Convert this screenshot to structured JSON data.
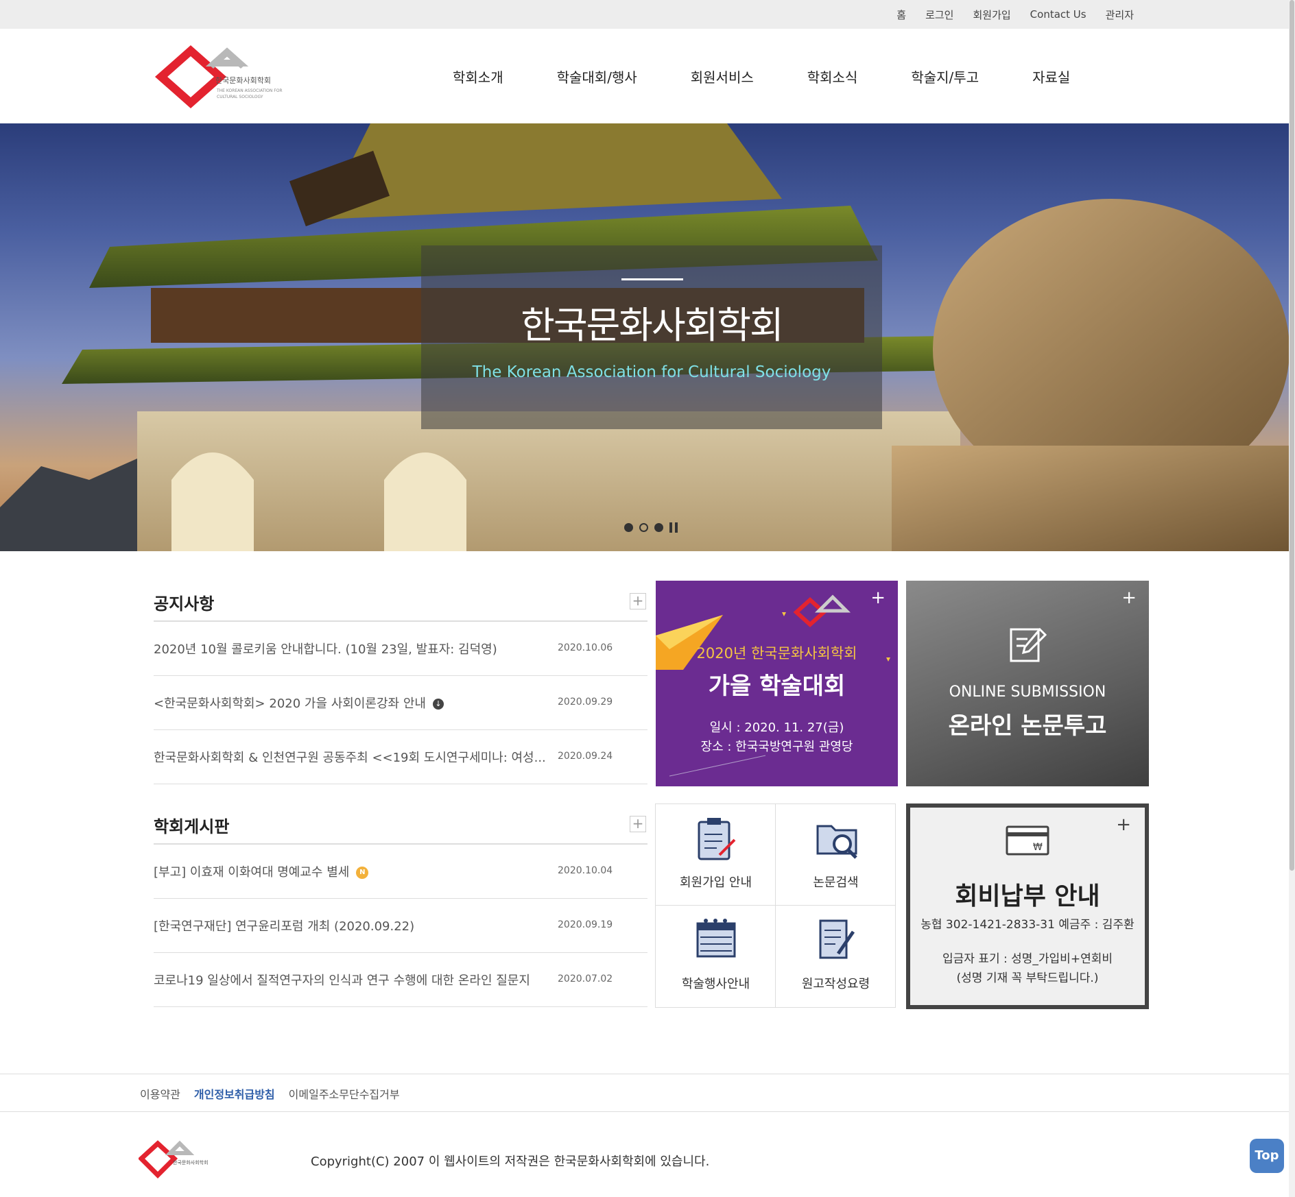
{
  "topbar": {
    "links": [
      "홈",
      "로그인",
      "회원가입",
      "Contact Us",
      "관리자"
    ]
  },
  "header": {
    "logo_ko": "한국문화사회학회",
    "logo_en1": "THE KOREAN ASSOCIATION FOR",
    "logo_en2": "CULTURAL SOCIOLOGY",
    "nav": [
      "학회소개",
      "학술대회/행사",
      "회원서비스",
      "학회소식",
      "학술지/투고",
      "자료실"
    ]
  },
  "hero": {
    "title": "한국문화사회학회",
    "subtitle": "The Korean Association for Cultural Sociology",
    "slides_total": 3,
    "active_slide": 1
  },
  "notice": {
    "title": "공지사항",
    "more": "+",
    "rows": [
      {
        "title": "2020년 10월 콜로키움 안내합니다. (10월 23일, 발표자: 김덕영)",
        "date": "2020.10.06",
        "badge": ""
      },
      {
        "title": "<한국문화사회학회> 2020 가을 사회이론강좌 안내",
        "date": "2020.09.29",
        "badge": "download"
      },
      {
        "title": "한국문화사회학회 & 인천연구원 공동주최 <<19회 도시연구세미나: 여성...",
        "date": "2020.09.24",
        "badge": ""
      }
    ]
  },
  "board": {
    "title": "학회게시판",
    "more": "+",
    "rows": [
      {
        "title": "[부고] 이효재 이화여대 명예교수 별세",
        "date": "2020.10.04",
        "badge": "N"
      },
      {
        "title": "[한국연구재단] 연구윤리포럼 개최 (2020.09.22)",
        "date": "2020.09.19",
        "badge": ""
      },
      {
        "title": "코로나19 일상에서 질적연구자의 인식과 연구 수행에 대한 온라인 질문지",
        "date": "2020.07.02",
        "badge": ""
      }
    ]
  },
  "banner_conference": {
    "year_label": "2020년 한국문화사회학회",
    "title": "가을 학술대회",
    "date": "일시 : 2020. 11. 27(금)",
    "place": "장소 : 한국국방연구원 관영당",
    "more": "+"
  },
  "banner_online": {
    "en": "ONLINE SUBMISSION",
    "ko": "온라인 논문투고",
    "more": "+"
  },
  "quick_menu": [
    {
      "label": "회원가입 안내",
      "icon": "clipboard-icon"
    },
    {
      "label": "논문검색",
      "icon": "folder-search-icon"
    },
    {
      "label": "학술행사안내",
      "icon": "calendar-icon"
    },
    {
      "label": "원고작성요령",
      "icon": "document-pen-icon"
    }
  ],
  "fee": {
    "title": "회비납부 안내",
    "account": "농협 302-1421-2833-31 예금주 : 김주환",
    "note1": "입금자 표기 : 성명_가입비+연회비",
    "note2": "(성명 기재 꼭 부탁드립니다.)",
    "more": "+"
  },
  "footer": {
    "links": [
      "이용약관",
      "개인정보취급방침",
      "이메일주소무단수집거부"
    ],
    "copyright": "Copyright(C) 2007 이 웹사이트의 저작권은 한국문화사회학회에 있습니다.",
    "top_button": "Top"
  },
  "colors": {
    "accent_red": "#e3232f",
    "conference_purple": "#6b2c91",
    "link_blue": "#2d5da8",
    "top_button": "#4b80c6"
  }
}
